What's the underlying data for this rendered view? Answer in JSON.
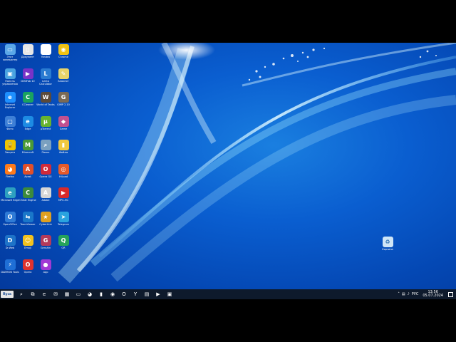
{
  "desktop": {
    "icons": [
      {
        "name": "этот-компьютер-icon",
        "label": "Этот компьютер",
        "color": "#5aa7e8",
        "glyph": "▭"
      },
      {
        "name": "документ-icon",
        "label": "Документ",
        "color": "#e6e6e6",
        "glyph": "▯"
      },
      {
        "name": "yandex-icon",
        "label": "Yandex",
        "color": "#ffffff",
        "glyph": "Y"
      },
      {
        "name": "chrome-icon",
        "label": "Chrome",
        "color": "#f2c313",
        "glyph": "◉"
      },
      {
        "name": "панель-управления-icon",
        "label": "Панель управления",
        "color": "#4aa3e0",
        "glyph": "▣"
      },
      {
        "name": "dvdfab-icon",
        "label": "DVDFab 10",
        "color": "#7a33c7",
        "glyph": "▶"
      },
      {
        "name": "lenta-icon",
        "label": "Lenta Calculator",
        "color": "#2a7bd1",
        "glyph": "L"
      },
      {
        "name": "notepad-icon",
        "label": "Блокнот",
        "color": "#e8d46a",
        "glyph": "✎"
      },
      {
        "name": "internet-explorer-icon",
        "label": "Internet Explorer",
        "color": "#1e90ff",
        "glyph": "e"
      },
      {
        "name": "ccleaner-icon",
        "label": "CCleaner",
        "color": "#1aa35f",
        "glyph": "C"
      },
      {
        "name": "wot-icon",
        "label": "World of Tanks",
        "color": "#5b4a3a",
        "glyph": "W"
      },
      {
        "name": "gimp-icon",
        "label": "GIMP 2.10",
        "color": "#7a6a55",
        "glyph": "G"
      },
      {
        "name": "фото-icon",
        "label": "Фото",
        "color": "#3d7fd6",
        "glyph": "▢"
      },
      {
        "name": "edge-icon",
        "label": "Edge",
        "color": "#1d8be3",
        "glyph": "e"
      },
      {
        "name": "utorrent-icon",
        "label": "µTorrent",
        "color": "#67b32e",
        "glyph": "µ"
      },
      {
        "name": "unreal-icon",
        "label": "Game",
        "color": "#c25190",
        "glyph": "◆"
      },
      {
        "name": "защита-icon",
        "label": "Защита",
        "color": "#f0c400",
        "glyph": "🔒"
      },
      {
        "name": "minecraft-icon",
        "label": "Minecraft",
        "color": "#4a9a37",
        "glyph": "M"
      },
      {
        "name": "поиск-icon",
        "label": "Поиск",
        "color": "#7aa0c0",
        "glyph": "⌕"
      },
      {
        "name": "файлы-icon",
        "label": "Файлы",
        "color": "#f0c840",
        "glyph": "▮"
      },
      {
        "name": "firefox-icon",
        "label": "Firefox",
        "color": "#ff7a1a",
        "glyph": "◕"
      },
      {
        "name": "avast-icon",
        "label": "Avast",
        "color": "#e04f2a",
        "glyph": "A"
      },
      {
        "name": "opera-gx-icon",
        "label": "Opera GX",
        "color": "#d12a3a",
        "glyph": "O"
      },
      {
        "name": "hiload-icon",
        "label": "HiLoad",
        "color": "#e55a2b",
        "glyph": "◎"
      },
      {
        "name": "microsoft-edge-icon",
        "label": "Microsoft Edge",
        "color": "#2da0c0",
        "glyph": "e"
      },
      {
        "name": "cheat-icon",
        "label": "Cheat Engine",
        "color": "#3c8a3c",
        "glyph": "C"
      },
      {
        "name": "adobe-icon",
        "label": "Adobe",
        "color": "#d6d6d6",
        "glyph": "A"
      },
      {
        "name": "mpc-icon",
        "label": "MPC-HC",
        "color": "#d82a2a",
        "glyph": "▶"
      },
      {
        "name": "openoffice-icon",
        "label": "OpenOffice",
        "color": "#2f7bd6",
        "glyph": "O"
      },
      {
        "name": "teamviewer-icon",
        "label": "TeamViewer",
        "color": "#1a77c9",
        "glyph": "⇆"
      },
      {
        "name": "cyberlink-icon",
        "label": "CyberLink",
        "color": "#e0a020",
        "glyph": "★"
      },
      {
        "name": "telegram-icon",
        "label": "Telegram",
        "color": "#2aa3df",
        "glyph": "➤"
      },
      {
        "name": "dr-web-icon",
        "label": "Dr.Web",
        "color": "#1e73c8",
        "glyph": "D"
      },
      {
        "name": "emoji-icon",
        "label": "Emoji",
        "color": "#f2c21e",
        "glyph": "☺"
      },
      {
        "name": "genshin-icon",
        "label": "Genshin",
        "color": "#b43a5a",
        "glyph": "G"
      },
      {
        "name": "qr-icon",
        "label": "QR",
        "color": "#25a35a",
        "glyph": "Q"
      },
      {
        "name": "daemon-icon",
        "label": "DAEMON Tools",
        "color": "#1f6fd6",
        "glyph": "⚡"
      },
      {
        "name": "opera-icon",
        "label": "Opera",
        "color": "#e0322e",
        "glyph": "O"
      },
      {
        "name": "app-icon",
        "label": "App",
        "color": "#a13ad4",
        "glyph": "●"
      }
    ],
    "recycle_bin": {
      "label": "Корзина"
    }
  },
  "taskbar": {
    "start_label": "Пуск",
    "pinned": [
      {
        "name": "search-taskbar-icon",
        "glyph": "⌕"
      },
      {
        "name": "task-view-icon",
        "glyph": "⧉"
      },
      {
        "name": "edge-taskbar-icon",
        "glyph": "e"
      },
      {
        "name": "mail-taskbar-icon",
        "glyph": "✉"
      },
      {
        "name": "store-taskbar-icon",
        "glyph": "▦"
      },
      {
        "name": "explorer-taskbar-icon",
        "glyph": "▭"
      },
      {
        "name": "firefox-taskbar-icon",
        "glyph": "◕"
      },
      {
        "name": "folder-taskbar-icon",
        "glyph": "▮"
      },
      {
        "name": "chrome-taskbar-icon",
        "glyph": "◉"
      },
      {
        "name": "opera-taskbar-icon",
        "glyph": "O"
      },
      {
        "name": "yandex-taskbar-icon",
        "glyph": "Y"
      },
      {
        "name": "document-taskbar-icon",
        "glyph": "▤"
      },
      {
        "name": "media-taskbar-icon",
        "glyph": "▶"
      },
      {
        "name": "app-taskbar-icon",
        "glyph": "▣"
      }
    ],
    "tray": {
      "language": "РУС",
      "time": "13:56",
      "date": "05.07.2024"
    }
  }
}
